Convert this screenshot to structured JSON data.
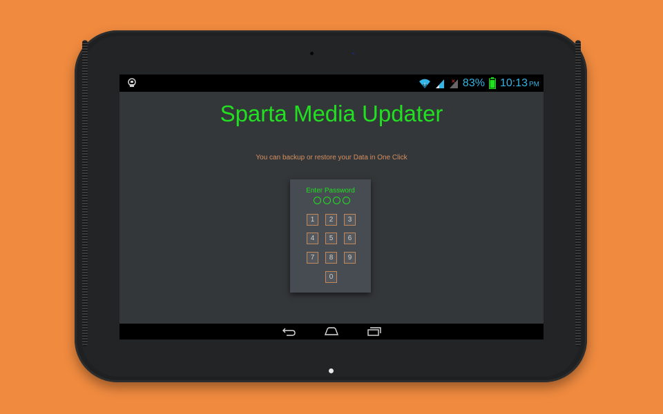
{
  "device": {
    "colors": {
      "background": "#ef8a3f",
      "bezel": "#1f2021"
    }
  },
  "statusbar": {
    "left_icon": "app-notification-icon",
    "icons": [
      "wifi-icon",
      "signal-icon",
      "signal-no-sim-icon",
      "battery-icon"
    ],
    "battery_pct": "83%",
    "time": "10:13",
    "ampm": "PM",
    "colors": {
      "status": "#33b5e5",
      "battery": "#22e021"
    }
  },
  "app": {
    "title": "Sparta Media Updater",
    "subtitle": "You can backup or restore your Data in One Click",
    "colors": {
      "title": "#22e021",
      "subtitle": "#d69060",
      "background": "#34373a"
    }
  },
  "lock": {
    "label": "Enter Password",
    "pin_length": 4,
    "keys": [
      "1",
      "2",
      "3",
      "4",
      "5",
      "6",
      "7",
      "8",
      "9",
      "0"
    ],
    "colors": {
      "accent": "#22e021",
      "key_border": "#c48a5c",
      "card": "#474c52"
    }
  },
  "navbar": {
    "buttons": [
      "back-icon",
      "home-icon",
      "recent-apps-icon"
    ]
  }
}
